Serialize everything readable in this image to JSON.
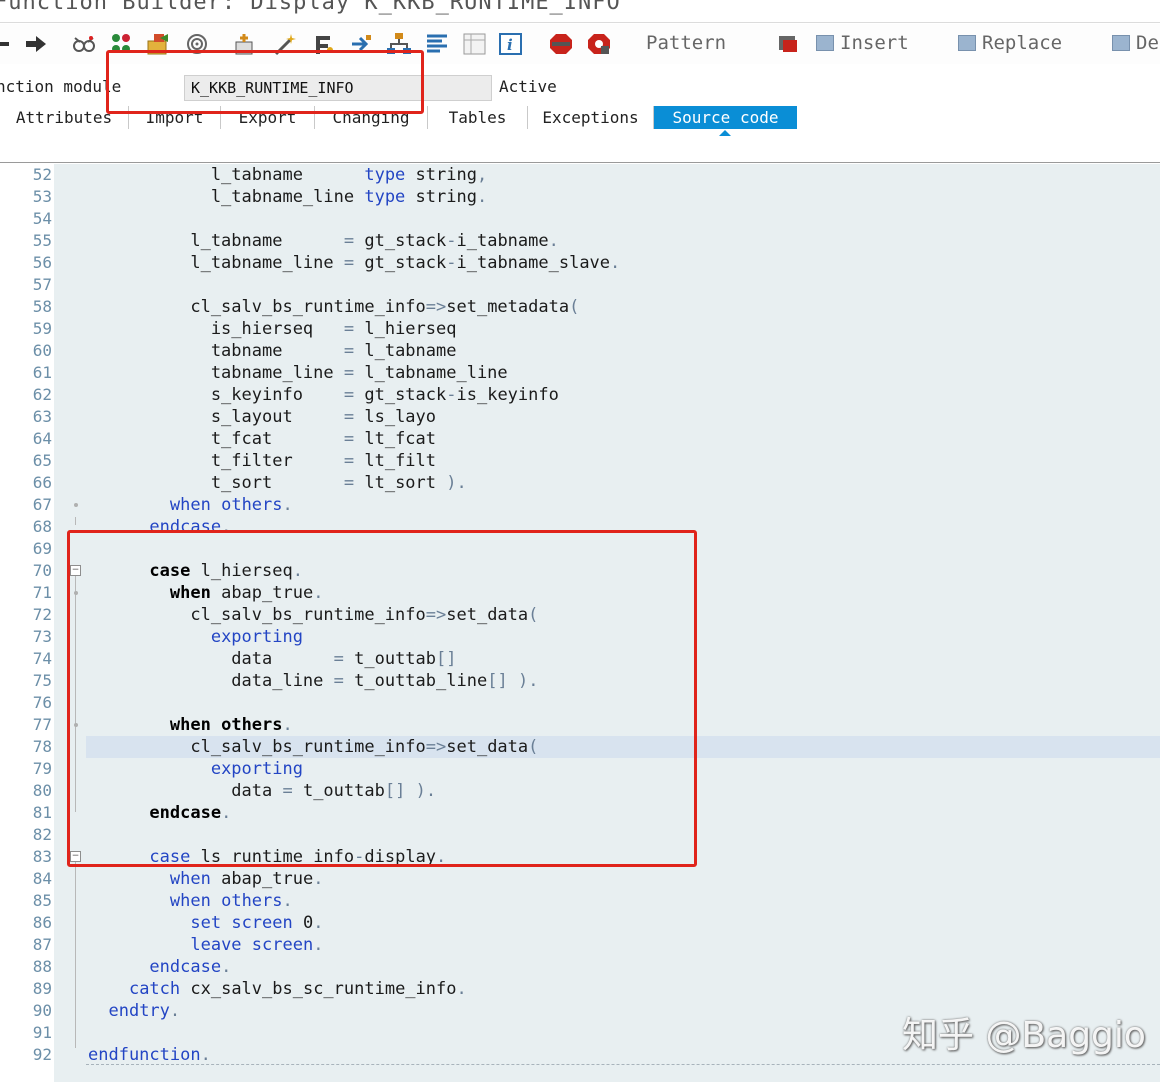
{
  "window": {
    "title": "Function Builder: Display K_KKB_RUNTIME_INFO"
  },
  "toolbar": {
    "icons": [
      "back-arrow-icon",
      "forward-arrow-icon",
      "glasses-icon",
      "object-list-icon",
      "other-object-icon",
      "where-used-icon",
      "activate-icon",
      "test-icon",
      "magic-wand-icon",
      "check-icon",
      "navigate-icon",
      "hierarchy-icon",
      "pretty-printer-icon",
      "display-object-list-icon",
      "info-icon",
      "breakpoint-icon",
      "external-breakpoint-icon"
    ],
    "pattern_label": "Pattern",
    "insert_label": "Insert",
    "replace_label": "Replace",
    "delete_label": "De"
  },
  "function_module": {
    "label": "nction module",
    "value": "K_KKB_RUNTIME_INFO",
    "status": "Active"
  },
  "tabs": [
    {
      "label": "Attributes"
    },
    {
      "label": "Import"
    },
    {
      "label": "Export"
    },
    {
      "label": "Changing"
    },
    {
      "label": "Tables"
    },
    {
      "label": "Exceptions"
    },
    {
      "label": "Source code"
    }
  ],
  "code_lines": [
    {
      "n": "52",
      "t": "            l_tabname      type string,"
    },
    {
      "n": "53",
      "t": "            l_tabname_line type string."
    },
    {
      "n": "54",
      "t": ""
    },
    {
      "n": "55",
      "t": "          l_tabname      = gt_stack-i_tabname."
    },
    {
      "n": "56",
      "t": "          l_tabname_line = gt_stack-i_tabname_slave."
    },
    {
      "n": "57",
      "t": ""
    },
    {
      "n": "58",
      "t": "          cl_salv_bs_runtime_info=>set_metadata("
    },
    {
      "n": "59",
      "t": "            is_hierseq   = l_hierseq"
    },
    {
      "n": "60",
      "t": "            tabname      = l_tabname"
    },
    {
      "n": "61",
      "t": "            tabname_line = l_tabname_line"
    },
    {
      "n": "62",
      "t": "            s_keyinfo    = gt_stack-is_keyinfo"
    },
    {
      "n": "63",
      "t": "            s_layout     = ls_layo"
    },
    {
      "n": "64",
      "t": "            t_fcat       = lt_fcat"
    },
    {
      "n": "65",
      "t": "            t_filter     = lt_filt"
    },
    {
      "n": "66",
      "t": "            t_sort       = lt_sort )."
    },
    {
      "n": "67",
      "t": "        when others."
    },
    {
      "n": "68",
      "t": "      endcase."
    },
    {
      "n": "69",
      "t": ""
    },
    {
      "n": "70",
      "t": "      case l_hierseq."
    },
    {
      "n": "71",
      "t": "        when abap_true."
    },
    {
      "n": "72",
      "t": "          cl_salv_bs_runtime_info=>set_data("
    },
    {
      "n": "73",
      "t": "            exporting"
    },
    {
      "n": "74",
      "t": "              data      = t_outtab[]"
    },
    {
      "n": "75",
      "t": "              data_line = t_outtab_line[] )."
    },
    {
      "n": "76",
      "t": ""
    },
    {
      "n": "77",
      "t": "        when others."
    },
    {
      "n": "78",
      "t": "          cl_salv_bs_runtime_info=>set_data("
    },
    {
      "n": "79",
      "t": "            exporting"
    },
    {
      "n": "80",
      "t": "              data = t_outtab[] )."
    },
    {
      "n": "81",
      "t": "      endcase."
    },
    {
      "n": "82",
      "t": ""
    },
    {
      "n": "83",
      "t": "      case ls_runtime_info-display."
    },
    {
      "n": "84",
      "t": "        when abap_true."
    },
    {
      "n": "85",
      "t": "        when others."
    },
    {
      "n": "86",
      "t": "          set screen 0."
    },
    {
      "n": "87",
      "t": "          leave screen."
    },
    {
      "n": "88",
      "t": "      endcase."
    },
    {
      "n": "89",
      "t": "    catch cx_salv_bs_sc_runtime_info."
    },
    {
      "n": "90",
      "t": "  endtry."
    },
    {
      "n": "91",
      "t": ""
    },
    {
      "n": "92",
      "t": "endfunction."
    }
  ],
  "current_line": "78",
  "watermark": "知乎 @Baggio",
  "colors": {
    "active_tab": "#0a8ed6",
    "highlight_box": "#e0241b",
    "keyword": "#2345c4",
    "editor_bg": "#e8eff1"
  }
}
